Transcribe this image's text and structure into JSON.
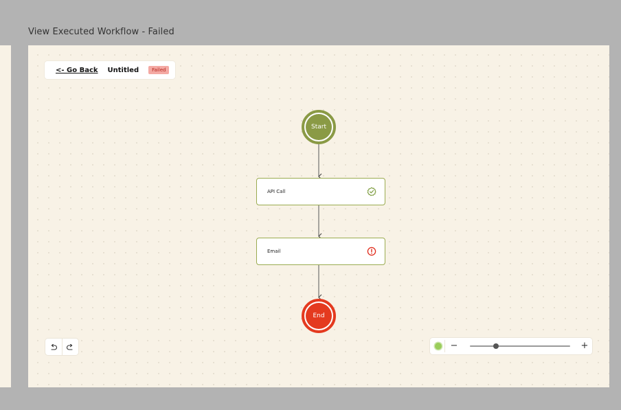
{
  "page": {
    "title": "View Executed Workflow - Failed"
  },
  "header": {
    "go_back_label": "<- Go Back",
    "workflow_name": "Untitled",
    "status": "Failed"
  },
  "nodes": {
    "start": {
      "label": "Start",
      "color": "#8a9a45"
    },
    "steps": [
      {
        "label": "API Call",
        "status": "success",
        "icon": "check-circle-icon",
        "icon_color": "#7a9a3a"
      },
      {
        "label": "Email",
        "status": "error",
        "icon": "alert-circle-icon",
        "icon_color": "#e02a1a"
      }
    ],
    "end": {
      "label": "End",
      "color": "#e43a1f"
    }
  },
  "controls": {
    "undo_icon": "undo-icon",
    "redo_icon": "redo-icon",
    "zoom_out_label": "−",
    "zoom_in_label": "+",
    "zoom_level": 0.26,
    "minimap_indicator_color": "#9acd5a"
  },
  "colors": {
    "canvas_bg": "#f8f2e6",
    "step_border": "#9aab4f",
    "failed_badge_bg": "#f4a9a3"
  }
}
